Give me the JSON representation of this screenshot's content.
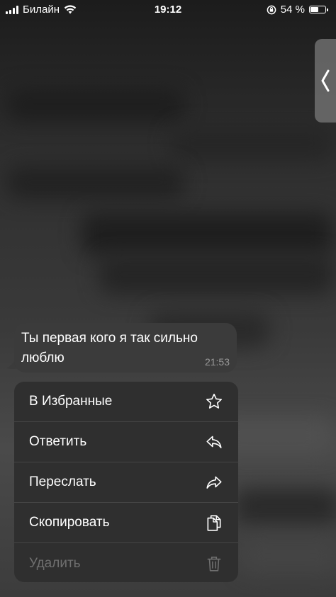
{
  "status_bar": {
    "carrier": "Билайн",
    "time": "19:12",
    "battery_percent": "54 %",
    "battery_level": 0.54
  },
  "message": {
    "text": "Ты первая кого я так сильно люблю",
    "time": "21:53"
  },
  "menu": {
    "items": [
      {
        "label": "В Избранные",
        "icon": "star-icon",
        "enabled": true
      },
      {
        "label": "Ответить",
        "icon": "reply-icon",
        "enabled": true
      },
      {
        "label": "Переслать",
        "icon": "forward-icon",
        "enabled": true
      },
      {
        "label": "Скопировать",
        "icon": "copy-icon",
        "enabled": true
      },
      {
        "label": "Удалить",
        "icon": "trash-icon",
        "enabled": false
      }
    ]
  },
  "colors": {
    "menu_background": "#2f2f2f",
    "bubble_background": "#3b3b3b",
    "disabled_text": "#6f6f6f"
  }
}
